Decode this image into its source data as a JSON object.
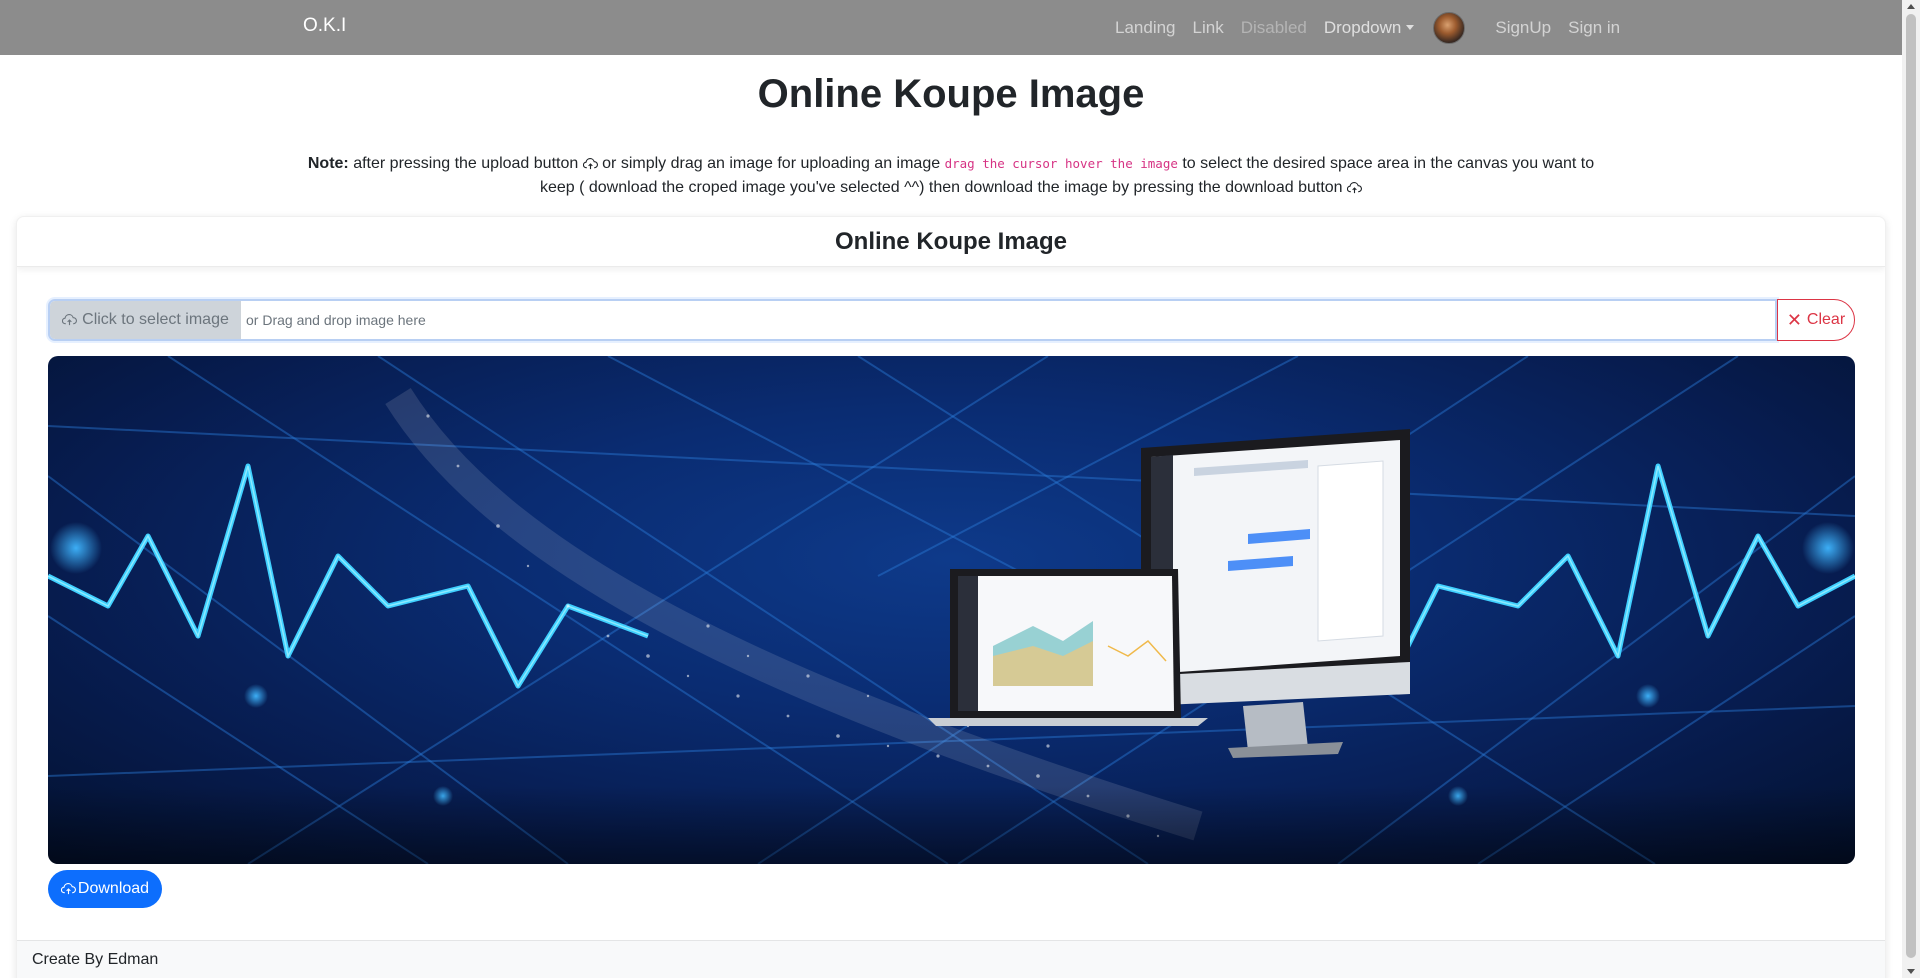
{
  "navbar": {
    "brand": "O.K.I",
    "links": [
      "Landing",
      "Link",
      "Disabled",
      "Dropdown",
      "SignUp",
      "Sign in"
    ]
  },
  "page": {
    "title": "Online Koupe Image",
    "note_label": "Note:",
    "note_part1": "after pressing the upload button",
    "note_part2": "or simply drag an image for uploading an image",
    "note_code": "drag the cursor hover the image",
    "note_part3": "to select the desired space area in the canvas you want to keep ( download the croped image you've selected ^^) then download the image by pressing the download button",
    "icon": "cloud-upload-icon"
  },
  "card": {
    "title": "Online Koupe Image",
    "select_label": "Click to select image",
    "drop_hint": "or Drag and drop image here",
    "clear_label": "Clear",
    "download_label": "Download",
    "footer": "Create By Edman"
  },
  "colors": {
    "navbar": "#8c8c8c",
    "primary": "#0d6efd",
    "danger": "#dc3545",
    "code": "#d63384"
  }
}
